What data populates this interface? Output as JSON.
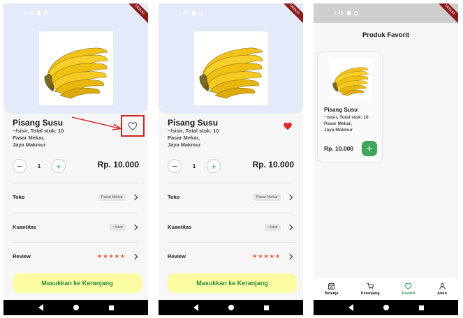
{
  "status_times": [
    "1:44",
    "1:45",
    "1:45"
  ],
  "debug_label": "DEBUG",
  "product": {
    "name": "Pisang Susu",
    "meta_line1": "~/sisir, Total stok: 10",
    "meta_line2": "Pasar Mekar,",
    "meta_line3": "Jaya Makmur",
    "quantity": "1",
    "price": "Rp. 10.000"
  },
  "rows": {
    "toko_label": "Toko",
    "toko_value": "Pasar Mekar",
    "kuantitas_label": "Kuantitas",
    "kuantitas_value": "~/sisir",
    "review_label": "Review",
    "review_stars": "★★★★★"
  },
  "cta_label": "Masukkan ke Keranjang",
  "favorites": {
    "title": "Produk Favorit",
    "price": "Rp. 10.000"
  },
  "bottom_nav": {
    "belanja": "Belanja",
    "keranjang": "Keranjang",
    "favorit": "Favorit",
    "akun": "Akun"
  },
  "colors": {
    "accent_green": "#2e9e4f",
    "heart_active": "#e0282e",
    "cta_bg": "#fbfca3",
    "hero_bg": "#e5eafb",
    "annotation_red": "#d32020"
  },
  "icons": {
    "heart_outline": "heart-outline-icon",
    "heart_filled": "heart-filled-icon",
    "chevron": "chevron-right-icon",
    "store": "store-icon",
    "cart": "cart-icon",
    "user": "user-icon"
  }
}
